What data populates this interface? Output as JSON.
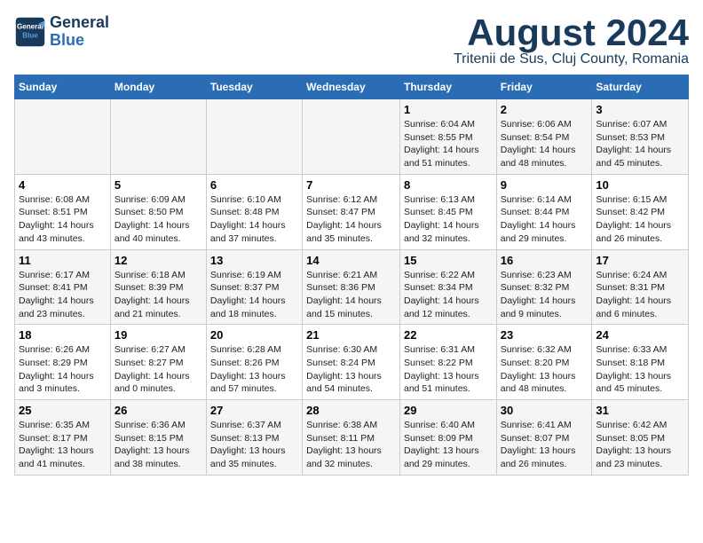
{
  "logo": {
    "line1": "General",
    "line2": "Blue"
  },
  "title": "August 2024",
  "subtitle": "Tritenii de Sus, Cluj County, Romania",
  "weekdays": [
    "Sunday",
    "Monday",
    "Tuesday",
    "Wednesday",
    "Thursday",
    "Friday",
    "Saturday"
  ],
  "weeks": [
    [
      {
        "day": "",
        "info": ""
      },
      {
        "day": "",
        "info": ""
      },
      {
        "day": "",
        "info": ""
      },
      {
        "day": "",
        "info": ""
      },
      {
        "day": "1",
        "info": "Sunrise: 6:04 AM\nSunset: 8:55 PM\nDaylight: 14 hours and 51 minutes."
      },
      {
        "day": "2",
        "info": "Sunrise: 6:06 AM\nSunset: 8:54 PM\nDaylight: 14 hours and 48 minutes."
      },
      {
        "day": "3",
        "info": "Sunrise: 6:07 AM\nSunset: 8:53 PM\nDaylight: 14 hours and 45 minutes."
      }
    ],
    [
      {
        "day": "4",
        "info": "Sunrise: 6:08 AM\nSunset: 8:51 PM\nDaylight: 14 hours and 43 minutes."
      },
      {
        "day": "5",
        "info": "Sunrise: 6:09 AM\nSunset: 8:50 PM\nDaylight: 14 hours and 40 minutes."
      },
      {
        "day": "6",
        "info": "Sunrise: 6:10 AM\nSunset: 8:48 PM\nDaylight: 14 hours and 37 minutes."
      },
      {
        "day": "7",
        "info": "Sunrise: 6:12 AM\nSunset: 8:47 PM\nDaylight: 14 hours and 35 minutes."
      },
      {
        "day": "8",
        "info": "Sunrise: 6:13 AM\nSunset: 8:45 PM\nDaylight: 14 hours and 32 minutes."
      },
      {
        "day": "9",
        "info": "Sunrise: 6:14 AM\nSunset: 8:44 PM\nDaylight: 14 hours and 29 minutes."
      },
      {
        "day": "10",
        "info": "Sunrise: 6:15 AM\nSunset: 8:42 PM\nDaylight: 14 hours and 26 minutes."
      }
    ],
    [
      {
        "day": "11",
        "info": "Sunrise: 6:17 AM\nSunset: 8:41 PM\nDaylight: 14 hours and 23 minutes."
      },
      {
        "day": "12",
        "info": "Sunrise: 6:18 AM\nSunset: 8:39 PM\nDaylight: 14 hours and 21 minutes."
      },
      {
        "day": "13",
        "info": "Sunrise: 6:19 AM\nSunset: 8:37 PM\nDaylight: 14 hours and 18 minutes."
      },
      {
        "day": "14",
        "info": "Sunrise: 6:21 AM\nSunset: 8:36 PM\nDaylight: 14 hours and 15 minutes."
      },
      {
        "day": "15",
        "info": "Sunrise: 6:22 AM\nSunset: 8:34 PM\nDaylight: 14 hours and 12 minutes."
      },
      {
        "day": "16",
        "info": "Sunrise: 6:23 AM\nSunset: 8:32 PM\nDaylight: 14 hours and 9 minutes."
      },
      {
        "day": "17",
        "info": "Sunrise: 6:24 AM\nSunset: 8:31 PM\nDaylight: 14 hours and 6 minutes."
      }
    ],
    [
      {
        "day": "18",
        "info": "Sunrise: 6:26 AM\nSunset: 8:29 PM\nDaylight: 14 hours and 3 minutes."
      },
      {
        "day": "19",
        "info": "Sunrise: 6:27 AM\nSunset: 8:27 PM\nDaylight: 14 hours and 0 minutes."
      },
      {
        "day": "20",
        "info": "Sunrise: 6:28 AM\nSunset: 8:26 PM\nDaylight: 13 hours and 57 minutes."
      },
      {
        "day": "21",
        "info": "Sunrise: 6:30 AM\nSunset: 8:24 PM\nDaylight: 13 hours and 54 minutes."
      },
      {
        "day": "22",
        "info": "Sunrise: 6:31 AM\nSunset: 8:22 PM\nDaylight: 13 hours and 51 minutes."
      },
      {
        "day": "23",
        "info": "Sunrise: 6:32 AM\nSunset: 8:20 PM\nDaylight: 13 hours and 48 minutes."
      },
      {
        "day": "24",
        "info": "Sunrise: 6:33 AM\nSunset: 8:18 PM\nDaylight: 13 hours and 45 minutes."
      }
    ],
    [
      {
        "day": "25",
        "info": "Sunrise: 6:35 AM\nSunset: 8:17 PM\nDaylight: 13 hours and 41 minutes."
      },
      {
        "day": "26",
        "info": "Sunrise: 6:36 AM\nSunset: 8:15 PM\nDaylight: 13 hours and 38 minutes."
      },
      {
        "day": "27",
        "info": "Sunrise: 6:37 AM\nSunset: 8:13 PM\nDaylight: 13 hours and 35 minutes."
      },
      {
        "day": "28",
        "info": "Sunrise: 6:38 AM\nSunset: 8:11 PM\nDaylight: 13 hours and 32 minutes."
      },
      {
        "day": "29",
        "info": "Sunrise: 6:40 AM\nSunset: 8:09 PM\nDaylight: 13 hours and 29 minutes."
      },
      {
        "day": "30",
        "info": "Sunrise: 6:41 AM\nSunset: 8:07 PM\nDaylight: 13 hours and 26 minutes."
      },
      {
        "day": "31",
        "info": "Sunrise: 6:42 AM\nSunset: 8:05 PM\nDaylight: 13 hours and 23 minutes."
      }
    ]
  ]
}
